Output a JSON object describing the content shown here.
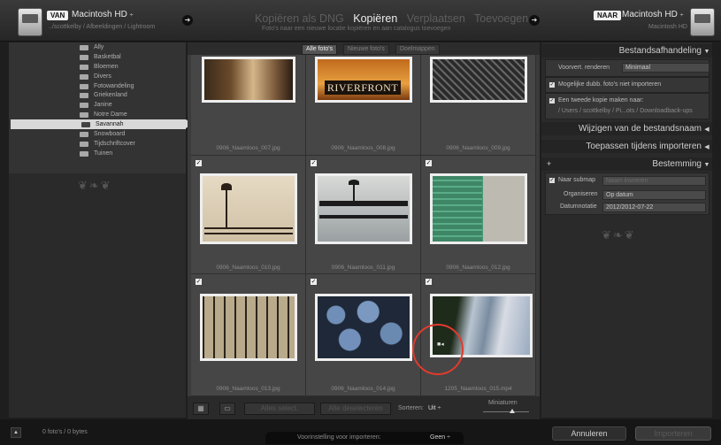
{
  "source": {
    "badge": "VAN",
    "name": "Macintosh HD",
    "path": "../scottkelby / Afbeeldingen / Lightroom"
  },
  "destination": {
    "badge": "NAAR",
    "name": "Macintosh HD",
    "sub": "Macintosh HD"
  },
  "modes": {
    "items": [
      "Kopiëren als DNG",
      "Kopiëren",
      "Verplaatsen",
      "Toevoegen"
    ],
    "active": "Kopiëren",
    "subtitle": "Foto's naar een nieuwe locatie kopiëren en aan catalogus toevoegen"
  },
  "folders": [
    "Ally",
    "Basketbal",
    "Bloemen",
    "Divers",
    "Fotowandeling",
    "Griekenland",
    "Janine",
    "Notre Dame",
    "Savannah",
    "Snowboard",
    "Tijdschriftcover",
    "Tuinen"
  ],
  "selected_folder": "Savannah",
  "filter_tabs": [
    "Alle foto's",
    "Nieuwe foto's",
    "Doelmappen"
  ],
  "photos": [
    {
      "file": "0906_Naamloos_007.jpg",
      "checked": false
    },
    {
      "file": "0906_Naamloos_008.jpg",
      "checked": false
    },
    {
      "file": "0906_Naamloos_009.jpg",
      "checked": false
    },
    {
      "file": "0906_Naamloos_010.jpg",
      "checked": true
    },
    {
      "file": "0906_Naamloos_011.jpg",
      "checked": true
    },
    {
      "file": "0906_Naamloos_012.jpg",
      "checked": true
    },
    {
      "file": "0906_Naamloos_013.jpg",
      "checked": true
    },
    {
      "file": "0906_Naamloos_014.jpg",
      "checked": true
    },
    {
      "file": "1205_Naamloos_015.mp4",
      "checked": true
    }
  ],
  "thumb_text": {
    "riverfront": "RIVERFRONT"
  },
  "toolbar": {
    "select_all": "Alles select.",
    "deselect_all": "Alle deselecteren",
    "sort_label": "Sorteren:",
    "sort_value": "Uit",
    "thumbnails_label": "Miniaturen"
  },
  "panels": {
    "file_handling": {
      "title": "Bestandsafhandeling",
      "preview_label": "Voorvert. renderen",
      "preview_value": "Minimaal",
      "dont_import_dupes": "Mogelijke dubb. foto's niet importeren",
      "second_copy": "Een tweede kopie maken naar:",
      "second_copy_path": "/ Users / scottkelby / Pi...ots / Downloadback-ups"
    },
    "rename": {
      "title": "Wijzigen van de bestandsnaam"
    },
    "apply": {
      "title": "Toepassen tijdens importeren"
    },
    "destination": {
      "title": "Bestemming",
      "subfolder_label": "Naar submap",
      "subfolder_placeholder": "Naam invoeren",
      "organize_label": "Organiseren",
      "organize_value": "Op datum",
      "date_format_label": "Datumnotatie",
      "date_format_value": "2012/2012-07-22"
    }
  },
  "footer": {
    "count": "0 foto's / 0 bytes",
    "preset_label": "Voorinstelling voor importeren:",
    "preset_value": "Geen",
    "cancel": "Annuleren",
    "import": "Importeren"
  },
  "colors": {
    "highlight_ring": "#e23a2e"
  }
}
